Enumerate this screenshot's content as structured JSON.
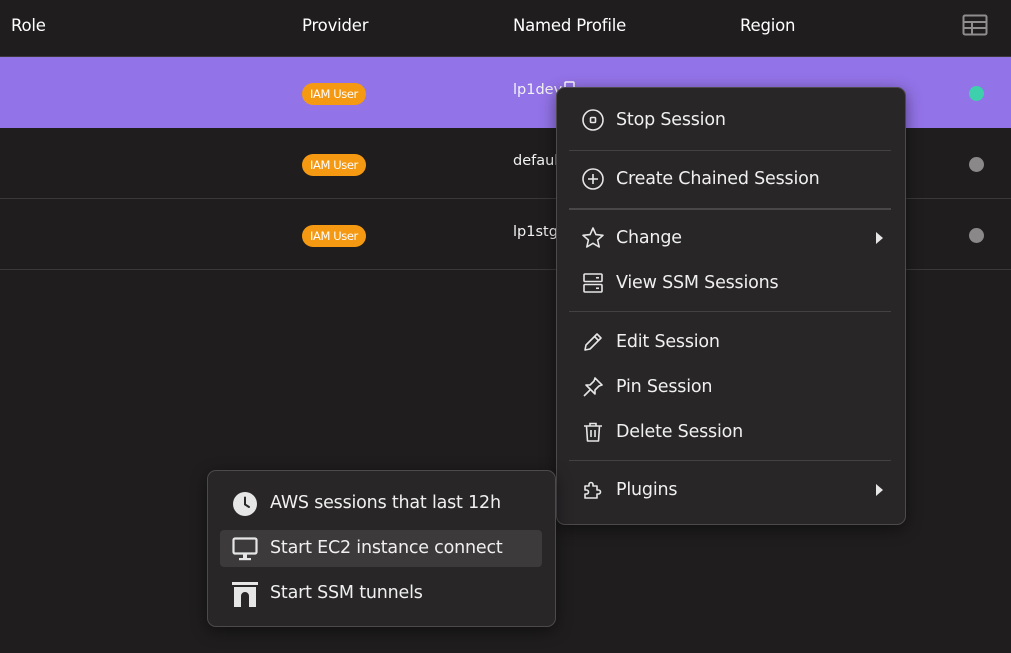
{
  "table": {
    "headers": {
      "role": "Role",
      "provider": "Provider",
      "named_profile": "Named Profile",
      "region": "Region"
    },
    "columns_icon": "table-columns-icon",
    "rows": [
      {
        "provider": "IAM User",
        "named_profile": "lp1dev",
        "status": "active",
        "status_color": "#3ed0ad",
        "selected": true
      },
      {
        "provider": "IAM User",
        "named_profile": "default",
        "status": "inactive",
        "status_color": "#8a8889",
        "selected": false
      },
      {
        "provider": "IAM User",
        "named_profile": "lp1stg",
        "status": "inactive",
        "status_color": "#8a8889",
        "selected": false
      }
    ]
  },
  "context_menu": {
    "items": [
      {
        "label": "Stop Session",
        "icon": "stop-circle-icon"
      },
      {
        "label": "Create Chained Session",
        "icon": "plus-circle-icon"
      },
      {
        "label": "Change",
        "icon": "star-icon",
        "has_submenu": true
      },
      {
        "label": "View SSM Sessions",
        "icon": "server-icon"
      },
      {
        "label": "Edit Session",
        "icon": "pencil-icon"
      },
      {
        "label": "Pin Session",
        "icon": "pin-icon"
      },
      {
        "label": "Delete Session",
        "icon": "trash-icon"
      },
      {
        "label": "Plugins",
        "icon": "puzzle-icon",
        "has_submenu": true
      }
    ]
  },
  "plugins_menu": {
    "items": [
      {
        "label": "AWS sessions that last 12h",
        "icon": "clock-icon"
      },
      {
        "label": "Start EC2 instance connect",
        "icon": "monitor-icon",
        "hovered": true
      },
      {
        "label": "Start SSM tunnels",
        "icon": "tunnel-icon"
      }
    ]
  },
  "colors": {
    "background": "#1f1d1e",
    "selected_row": "#9373e8",
    "badge": "#f59812",
    "menu_bg": "#282627"
  }
}
